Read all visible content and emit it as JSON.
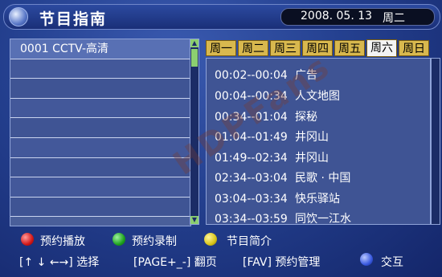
{
  "header": {
    "title": "节目指南",
    "date": "2008. 05. 13",
    "weekday": "周二"
  },
  "channels": [
    {
      "label": "0001  CCTV-高清"
    },
    {
      "label": ""
    },
    {
      "label": ""
    },
    {
      "label": ""
    },
    {
      "label": ""
    },
    {
      "label": ""
    },
    {
      "label": ""
    },
    {
      "label": ""
    },
    {
      "label": ""
    }
  ],
  "tabs": [
    {
      "label": "周一"
    },
    {
      "label": "周二"
    },
    {
      "label": "周三"
    },
    {
      "label": "周四"
    },
    {
      "label": "周五"
    },
    {
      "label": "周六"
    },
    {
      "label": "周日"
    }
  ],
  "active_tab": "周六",
  "programs": [
    {
      "time": "00:02--00:04",
      "name": "广告"
    },
    {
      "time": "00:04--00:34",
      "name": "人文地图"
    },
    {
      "time": "00:34--01:04",
      "name": "探秘"
    },
    {
      "time": "01:04--01:49",
      "name": "井冈山"
    },
    {
      "time": "01:49--02:34",
      "name": "井冈山"
    },
    {
      "time": "02:34--03:04",
      "name": "民歌 · 中国"
    },
    {
      "time": "03:04--03:34",
      "name": "快乐驿站"
    },
    {
      "time": "03:34--03:59",
      "name": "同饮一江水"
    }
  ],
  "legend": {
    "red": "预约播放",
    "green": "预约录制",
    "yellow": "节目简介",
    "nav": "[↑ ↓ ←→]  选择",
    "page": "[PAGE+_-]  翻页",
    "fav": "[FAV]  预约管理",
    "blue": "交互"
  },
  "watermark": "HDPFans",
  "colors": {
    "background": "#24408f",
    "tab": "#d8b84e",
    "tab_active": "#f4f4f4",
    "scrollbar": "#8ccf70"
  }
}
